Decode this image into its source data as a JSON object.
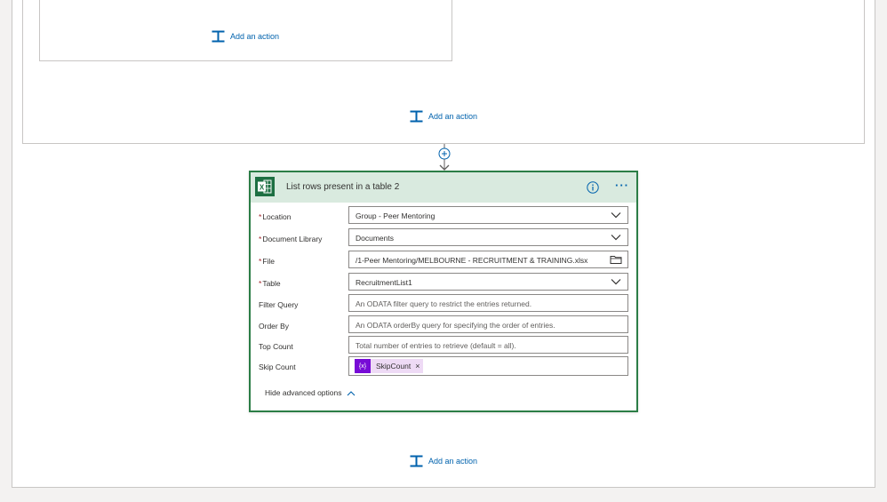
{
  "add_action_label": "Add an action",
  "card": {
    "title": "List rows present in a table 2",
    "hide_advanced": "Hide advanced options",
    "fields": {
      "location": {
        "label": "Location",
        "required": "*",
        "value": "Group - Peer Mentoring"
      },
      "document_library": {
        "label": "Document Library",
        "required": "*",
        "value": "Documents"
      },
      "file": {
        "label": "File",
        "required": "*",
        "value": "/1-Peer Mentoring/MELBOURNE - RECRUITMENT & TRAINING.xlsx"
      },
      "table": {
        "label": "Table",
        "required": "*",
        "value": "RecruitmentList1"
      },
      "filter_query": {
        "label": "Filter Query",
        "placeholder": "An ODATA filter query to restrict the entries returned."
      },
      "order_by": {
        "label": "Order By",
        "placeholder": "An ODATA orderBy query for specifying the order of entries."
      },
      "top_count": {
        "label": "Top Count",
        "placeholder": "Total number of entries to retrieve (default = all)."
      },
      "skip_count": {
        "label": "Skip Count",
        "token_icon": "{x}",
        "token_label": "SkipCount",
        "token_close": "×"
      }
    }
  },
  "icons": {
    "excel": "excel-icon",
    "info": "info-icon",
    "more": "more-options-icon",
    "dropdown": "chevron-down-icon",
    "folder": "folder-icon",
    "add_action": "add-action-icon",
    "connector": "plus-connector-icon"
  },
  "colors": {
    "accent": "#0062ad",
    "card_border": "#2b7d46",
    "card_header": "#d9eadf",
    "excel_green": "#1d6f42",
    "token": "#770bd6",
    "token_bg": "#eedaf5",
    "required": "#a4262c"
  }
}
